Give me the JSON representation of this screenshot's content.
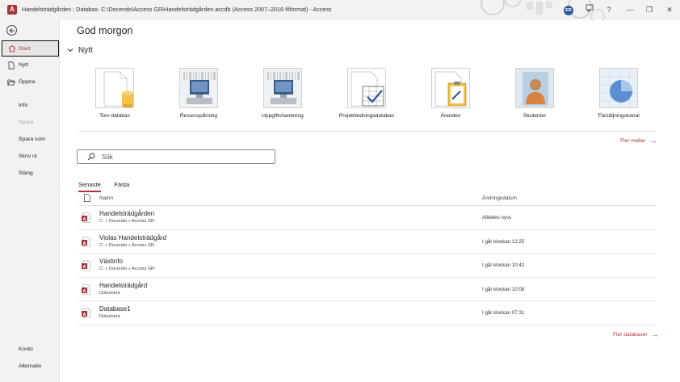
{
  "window": {
    "title": "Handelsträdgården : Databas- C:\\Docendo\\Access GR\\Handelsträdgården.accdb (Access 2007–2016-filformat)  -  Access",
    "app_icon_letter": "A",
    "user_initials": "ER",
    "controls": {
      "help": "?",
      "minimize": "—",
      "restore": "❐",
      "close": "✕"
    }
  },
  "sidebar": {
    "items": [
      {
        "label": "Start",
        "icon": "home-icon",
        "active": true
      },
      {
        "label": "Nytt",
        "icon": "new-document-icon"
      },
      {
        "label": "Öppna",
        "icon": "folder-open-icon"
      },
      {
        "label": "Info"
      },
      {
        "label": "Spara",
        "disabled": true
      },
      {
        "label": "Spara som"
      },
      {
        "label": "Skriv ut"
      },
      {
        "label": "Stäng"
      }
    ],
    "bottom_items": [
      {
        "label": "Konto"
      },
      {
        "label": "Alternativ"
      }
    ]
  },
  "main": {
    "greeting": "God morgon",
    "new_section": {
      "title": "Nytt"
    },
    "templates": [
      {
        "label": "Tom databas",
        "icon": "blank-database-icon"
      },
      {
        "label": "Resursspårning",
        "icon": "asset-tracking-icon"
      },
      {
        "label": "Uppgiftshantering",
        "icon": "task-management-icon"
      },
      {
        "label": "Projektledningsdatabas",
        "icon": "project-management-icon"
      },
      {
        "label": "Ärenden",
        "icon": "issues-icon"
      },
      {
        "label": "Studenter",
        "icon": "students-icon"
      },
      {
        "label": "Försäljningskanal",
        "icon": "sales-pipeline-icon"
      }
    ],
    "more_templates": "Fler mallar",
    "search": {
      "placeholder": "Sök"
    },
    "tabs": [
      {
        "label": "Senaste",
        "active": true
      },
      {
        "label": "Fästa"
      }
    ],
    "table": {
      "col_name": "Namn",
      "col_date": "Ändringsdatum",
      "rows": [
        {
          "name": "Handelsträdgården",
          "path": "C: » Docendo » Access GR",
          "date": "Alldeles nyss"
        },
        {
          "name": "Violas Handelsträdgård",
          "path": "C: » Docendo » Access GR",
          "date": "I går klockan 12:25"
        },
        {
          "name": "Växtinfo",
          "path": "C: » Docendo » Access GR",
          "date": "I går klockan 10:42"
        },
        {
          "name": "Handelsträdgård",
          "path": "Dokument",
          "date": "I går klockan 10:08"
        },
        {
          "name": "Database1",
          "path": "Dokument",
          "date": "I går klockan 07:31"
        }
      ]
    },
    "more_databases": "Fler databaser"
  },
  "colors": {
    "accent": "#a4373a",
    "sidebar_bg": "#f3f2f1",
    "avatar": "#2b579a"
  }
}
